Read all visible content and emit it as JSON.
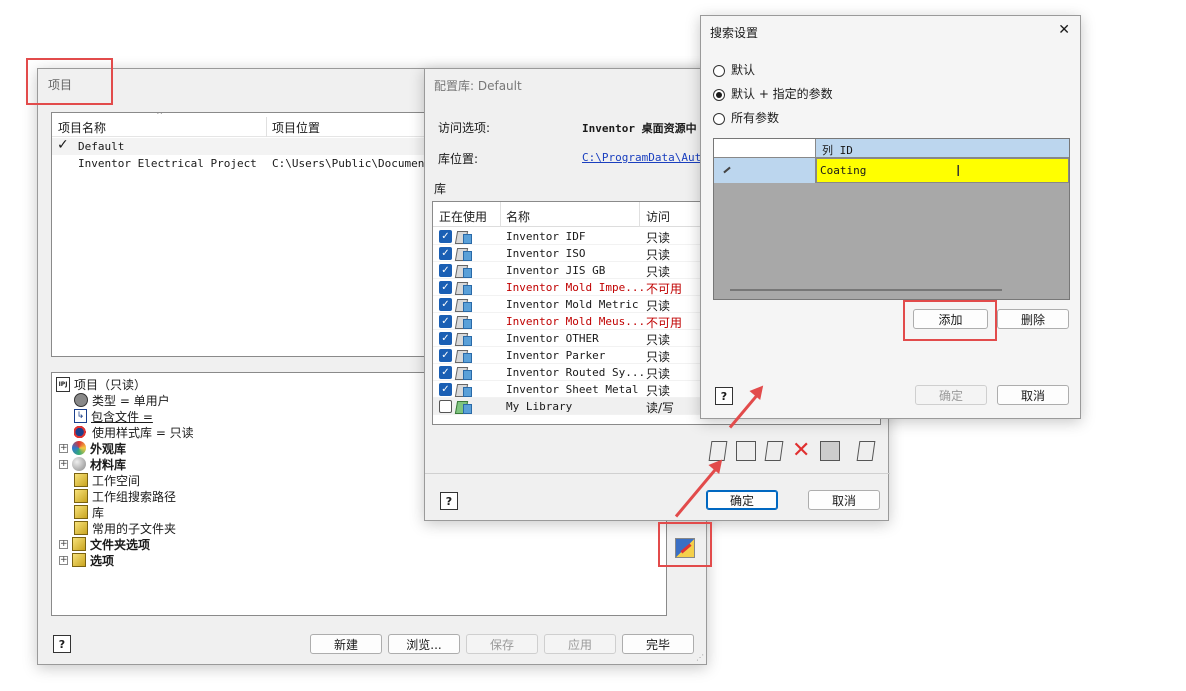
{
  "project_dialog": {
    "title": "项目",
    "columns": [
      "项目名称",
      "项目位置"
    ],
    "rows": [
      {
        "check": "✓",
        "name": "Default",
        "location": ""
      },
      {
        "check": "",
        "name": "Inventor Electrical Project",
        "location": "C:\\Users\\Public\\Documents\\"
      }
    ],
    "tree": [
      {
        "label": "项目（只读）",
        "bold": false
      },
      {
        "label": "类型 = 单用户",
        "bold": false
      },
      {
        "label": "包含文件 =",
        "bold": false
      },
      {
        "label": "使用样式库 = 只读",
        "bold": false
      },
      {
        "label": "外观库",
        "bold": true
      },
      {
        "label": "材料库",
        "bold": true
      },
      {
        "label": "工作空间",
        "bold": false
      },
      {
        "label": "工作组搜索路径",
        "bold": false
      },
      {
        "label": "库",
        "bold": false
      },
      {
        "label": "常用的子文件夹",
        "bold": false
      },
      {
        "label": "文件夹选项",
        "bold": true
      },
      {
        "label": "选项",
        "bold": true
      }
    ],
    "buttons": {
      "new": "新建",
      "browse": "浏览...",
      "save": "保存",
      "apply": "应用",
      "done": "完毕"
    },
    "help": "?"
  },
  "config_dialog": {
    "title": "配置库: Default",
    "access_label": "访问选项:",
    "access_value": "Inventor 桌面资源中",
    "location_label": "库位置:",
    "location_value": "C:\\ProgramData\\Autod",
    "lib_section": "库",
    "columns": [
      "正在使用",
      "名称",
      "访问"
    ],
    "libs": [
      {
        "on": true,
        "name": "Inventor IDF",
        "access": "只读",
        "red": false
      },
      {
        "on": true,
        "name": "Inventor ISO",
        "access": "只读",
        "red": false
      },
      {
        "on": true,
        "name": "Inventor JIS GB",
        "access": "只读",
        "red": false
      },
      {
        "on": true,
        "name": "Inventor Mold Impe...",
        "access": "不可用",
        "red": true
      },
      {
        "on": true,
        "name": "Inventor Mold Metric",
        "access": "只读",
        "red": false
      },
      {
        "on": true,
        "name": "Inventor Mold Meus...",
        "access": "不可用",
        "red": true
      },
      {
        "on": true,
        "name": "Inventor OTHER",
        "access": "只读",
        "red": false
      },
      {
        "on": true,
        "name": "Inventor Parker",
        "access": "只读",
        "red": false
      },
      {
        "on": true,
        "name": "Inventor Routed Sy...",
        "access": "只读",
        "red": false
      },
      {
        "on": true,
        "name": "Inventor Sheet Metal",
        "access": "只读",
        "red": false
      },
      {
        "on": false,
        "name": "My Library",
        "access": "读/写",
        "red": false
      }
    ],
    "ok": "确定",
    "cancel": "取消",
    "help": "?"
  },
  "search_dialog": {
    "title": "搜索设置",
    "close": "✕",
    "options": [
      {
        "label": "默认",
        "selected": false
      },
      {
        "label": "默认 + 指定的参数",
        "selected": true
      },
      {
        "label": "所有参数",
        "selected": false
      }
    ],
    "grid_header": "列 ID",
    "grid_value": "Coating",
    "add": "添加",
    "delete": "删除",
    "ok": "确定",
    "cancel": "取消",
    "help": "?"
  },
  "colors": {
    "highlight": "#e24b4b",
    "accent": "#1a5fb4",
    "yellow": "#ffff00",
    "grid_header": "#bcd6ee"
  }
}
